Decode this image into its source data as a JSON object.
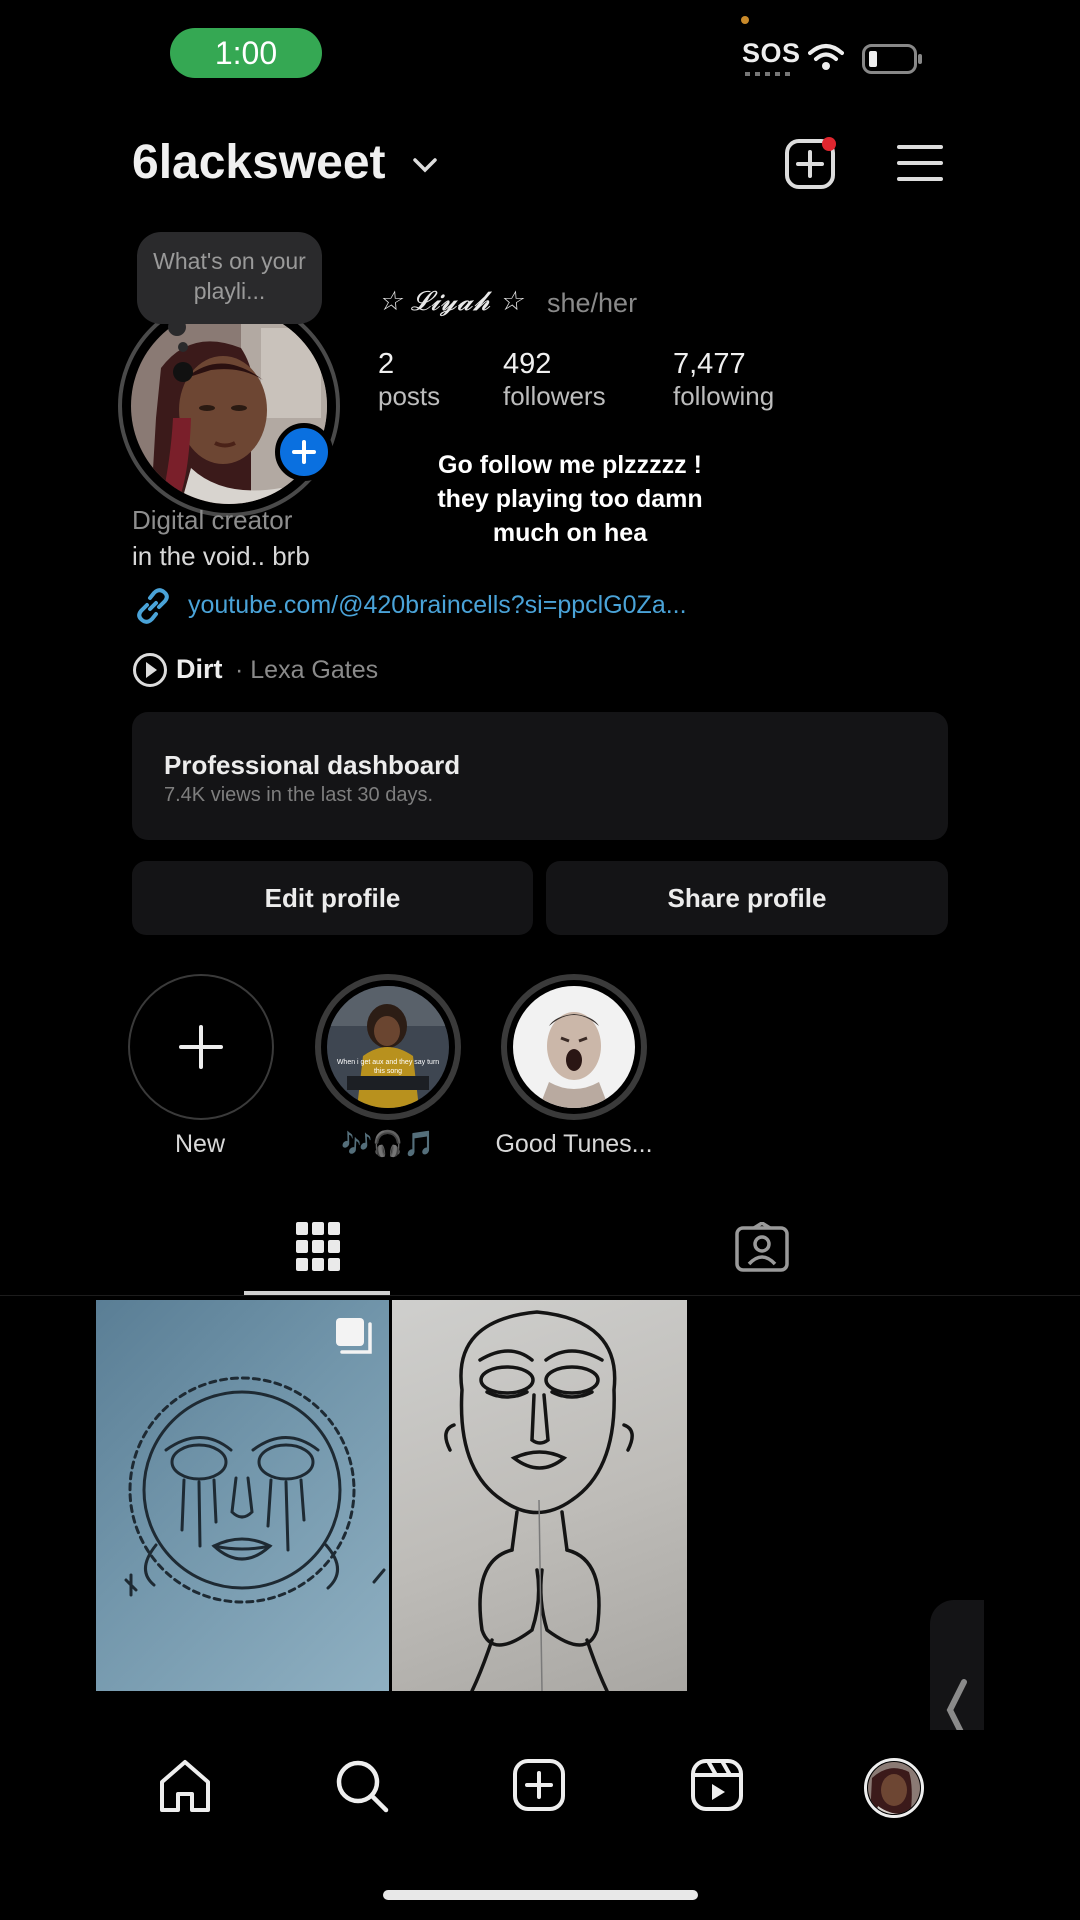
{
  "status_bar": {
    "time": "1:00",
    "sos": "SOS"
  },
  "header": {
    "username": "6lacksweet"
  },
  "profile": {
    "note": "What's on your playli...",
    "display_name": "☆ 𝓛𝓲𝔂𝓪𝓱 ☆",
    "pronouns": "she/her",
    "stats": {
      "posts": {
        "value": "2",
        "label": "posts"
      },
      "followers": {
        "value": "492",
        "label": "followers"
      },
      "following": {
        "value": "7,477",
        "label": "following"
      }
    },
    "category": "Digital creator",
    "bio": "in the void.. brb",
    "link": "youtube.com/@420braincells?si=ppclG0Za...",
    "music": {
      "title": "Dirt",
      "artist": "· Lexa Gates"
    }
  },
  "overlay_caption": [
    "Go follow me plzzzzz !",
    "they playing too damn",
    "much on hea"
  ],
  "dashboard": {
    "title": "Professional dashboard",
    "subtitle": "7.4K views in the last 30 days."
  },
  "buttons": {
    "edit": "Edit profile",
    "share": "Share profile"
  },
  "highlights": [
    {
      "label": "New"
    },
    {
      "label": "🎶🎧🎵",
      "thumb_caption": "When i get aux and they say turn this song"
    },
    {
      "label": "Good Tunes..."
    }
  ],
  "colors": {
    "accent_blue": "#0a70e0",
    "time_green": "#35a853",
    "link": "#4aa3d8",
    "notification": "#e0262f"
  },
  "icons": [
    "create-icon",
    "menu-icon",
    "link-icon",
    "play-icon",
    "grid-icon",
    "tagged-icon",
    "home-icon",
    "search-icon",
    "add-post-icon",
    "reels-icon",
    "profile-icon"
  ]
}
